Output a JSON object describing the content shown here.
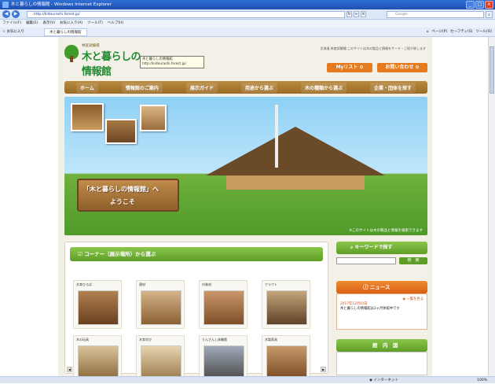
{
  "window": {
    "title": "木と暮らしの情報館 - Windows Internet Explorer",
    "buttons": [
      "_",
      "□",
      "×"
    ]
  },
  "address": {
    "url": "http://kidourashi.forest.jp/",
    "search_placeholder": "Google"
  },
  "menubar": [
    "ファイル(F)",
    "編集(E)",
    "表示(V)",
    "お気に入り(A)",
    "ツール(T)",
    "ヘルプ(H)"
  ],
  "favbar": {
    "favorites": "お気に入り",
    "tab": "木と暮らしの情報館",
    "tools": [
      "ページ(P)",
      "セーフティ(S)",
      "ツール(O)"
    ]
  },
  "status": {
    "zone": "インターネット",
    "zoom": "100%"
  },
  "site": {
    "logo_sub": "林産試験場",
    "logo_main": "木と暮らしの情報館",
    "tooltip_line1": "木と暮らしの情報館",
    "tooltip_line2": "http://kidourashi.forest.jp/",
    "top_note": "北海道 林産試験場 このサイトは木の製品と情報をサーチ・ご紹介致します",
    "mylist": "Myリスト",
    "contact": "お問い合わせ",
    "gnav": [
      "ホーム",
      "情報館のご案内",
      "展示ガイド",
      "用途から選ぶ",
      "木の種類から選ぶ",
      "企業・団体を探す"
    ],
    "hero_sign_l1": "「木と暮らしの情報館」へ",
    "hero_sign_l2": "ようこそ",
    "hero_caption": "※このサイトは木の製品と情報を検索できます",
    "corner_title": "コーナー（展示場所）から選ぶ",
    "tiles_row1": [
      "木育ひろば",
      "建材",
      "内装材",
      "クラフト"
    ],
    "tiles_row2": [
      "木の玩具",
      "木育学び",
      "りんさんし体験館",
      "木製家具"
    ],
    "keyword_title": "キーワードで探す",
    "keyword_btn": "検　索",
    "news_title": "ニュース",
    "news_more": "一覧を見る",
    "news_date": "2017年12月01日",
    "news_text": "木と暮らしの情報館は2ヶ月休館中です",
    "map_title": "館　内　図"
  }
}
